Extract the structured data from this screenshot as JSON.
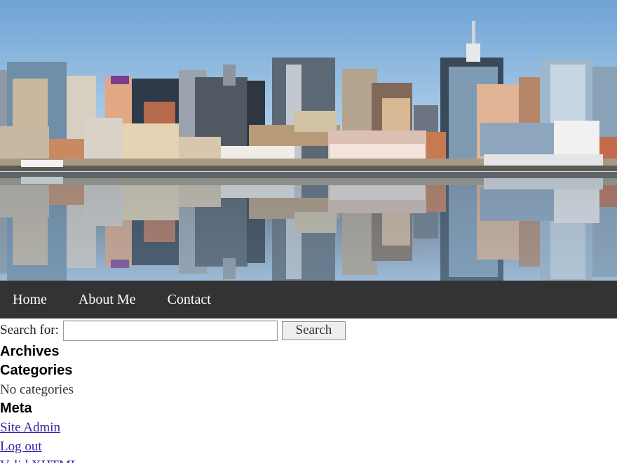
{
  "header": {
    "banner_image": "city-skyline-reflection-photo"
  },
  "nav": {
    "items": [
      {
        "label": "Home"
      },
      {
        "label": "About Me"
      },
      {
        "label": "Contact"
      }
    ]
  },
  "search": {
    "label": "Search for:",
    "value": "",
    "button_label": "Search"
  },
  "archives": {
    "heading": "Archives"
  },
  "categories": {
    "heading": "Categories",
    "empty_text": "No categories"
  },
  "meta": {
    "heading": "Meta",
    "links": [
      {
        "label": "Site Admin"
      },
      {
        "label": "Log out"
      },
      {
        "label": "Valid XHTML"
      }
    ]
  },
  "colors": {
    "nav_background": "#333333",
    "link": "#3a1fa8",
    "sky": "#a9cbe8",
    "water": "#8fb4d6"
  }
}
